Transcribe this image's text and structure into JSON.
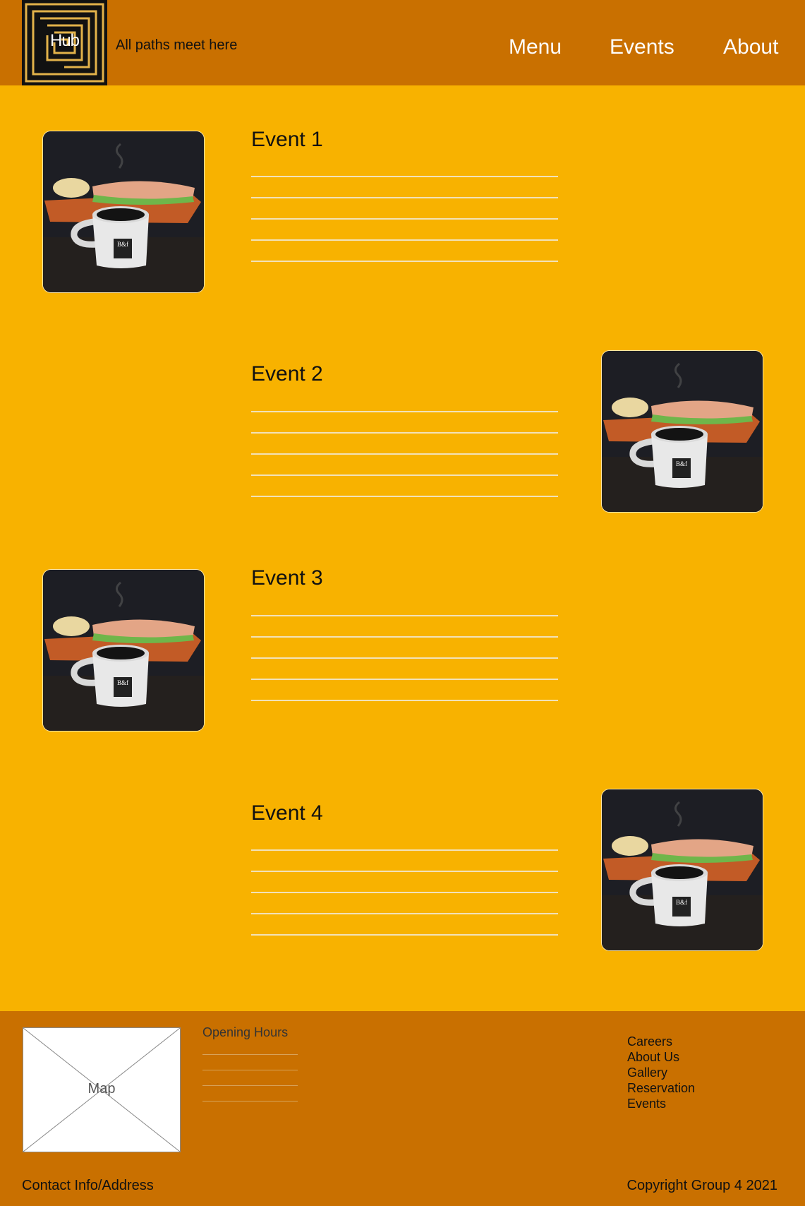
{
  "header": {
    "logo_text": "Hub",
    "tagline": "All paths meet here",
    "nav": [
      "Menu",
      "Events",
      "About"
    ]
  },
  "events": [
    {
      "title": "Event 1",
      "image_side": "left"
    },
    {
      "title": "Event 2",
      "image_side": "right"
    },
    {
      "title": "Event 3",
      "image_side": "left"
    },
    {
      "title": "Event 4",
      "image_side": "right"
    }
  ],
  "footer": {
    "map_label": "Map",
    "hours_title": "Opening Hours",
    "links": [
      "Careers",
      "About Us",
      "Gallery",
      "Reservation",
      "Events"
    ],
    "contact": "Contact Info/Address",
    "copyright": "Copyright Group 4 2021"
  },
  "colors": {
    "header_bg": "#c97000",
    "page_bg": "#f8b200",
    "footer_bg": "#c97000"
  }
}
